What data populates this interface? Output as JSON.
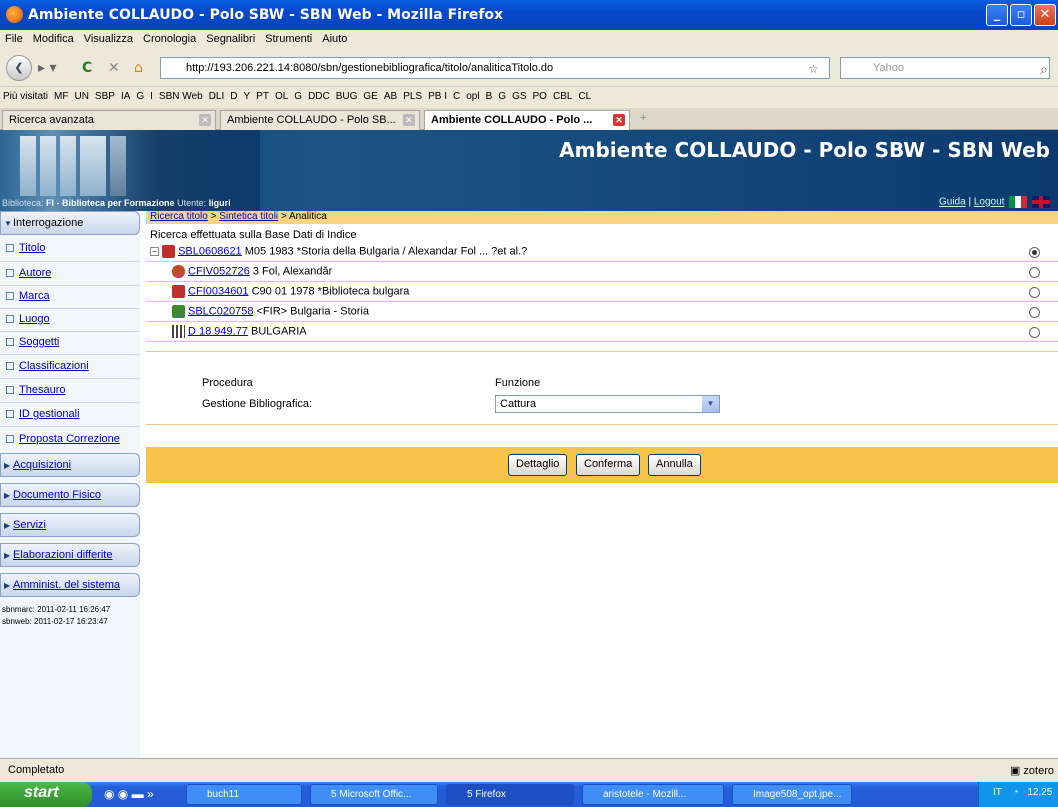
{
  "window": {
    "title": "Ambiente COLLAUDO - Polo SBW - SBN Web - Mozilla Firefox"
  },
  "menu": [
    "File",
    "Modifica",
    "Visualizza",
    "Cronologia",
    "Segnalibri",
    "Strumenti",
    "Aiuto"
  ],
  "nav": {
    "url": "http://193.206.221.14:8080/sbn/gestionebibliografica/titolo/analiticaTitolo.do",
    "search_placeholder": "Yahoo"
  },
  "bookmarks": [
    "Più visitati",
    "MF",
    "UN",
    "SBP",
    "IA",
    "G",
    "I",
    "SBN Web",
    "DLI",
    "D",
    "Y",
    "PT",
    "OL",
    "G",
    "DDC",
    "BUG",
    "GE",
    "AB",
    "PLS",
    "PB I",
    "C",
    "opl",
    "B",
    "G",
    "GS",
    "PO",
    "CBL",
    "CL"
  ],
  "tabs": [
    {
      "label": "Ricerca avanzata"
    },
    {
      "label": "Ambiente COLLAUDO - Polo SB..."
    },
    {
      "label": "Ambiente COLLAUDO - Polo ..."
    }
  ],
  "banner": {
    "title": "Ambiente COLLAUDO - Polo SBW - SBN Web",
    "biblioteca_label": "Biblioteca:",
    "biblioteca_value": "FI - Biblioteca per Formazione",
    "utente_label": "Utente:",
    "utente_value": "liguri",
    "guida": "Guida",
    "logout": "Logout"
  },
  "sidebar": {
    "interrogazione": "Interrogazione",
    "items": [
      "Titolo",
      "Autore",
      "Marca",
      "Luogo",
      "Soggetti",
      "Classificazioni",
      "Thesauro",
      "ID gestionali",
      "Proposta Correzione"
    ],
    "sections": [
      "Acquisizioni",
      "Documento Fisico",
      "Servizi",
      "Elaborazioni differite",
      "Amminist. del sistema"
    ],
    "stamp1": "sbnmarc: 2011-02-11 16:26:47",
    "stamp2": "sbnweb: 2011-02-17 16:23:47"
  },
  "breadcrumb": {
    "c1": "Ricerca titolo",
    "sep": " > ",
    "c2": "Sintetica titoli",
    "c3": "Analitica"
  },
  "main": {
    "search_note": "Ricerca effettuata sulla Base Dati di Indice",
    "records": [
      {
        "id": "SBL0608621",
        "text": " M05 1983 *Storia della Bulgaria / Alexandar Fol ... ?et al.?"
      },
      {
        "id": "CFIV052726",
        "text": " 3 Fol, Alexandăr"
      },
      {
        "id": "CFI0034601",
        "text": " C90 01 1978 *Biblioteca bulgara"
      },
      {
        "id": "SBLC020758",
        "text": " <FIR> Bulgaria - Storia"
      },
      {
        "id": "D 18 949.77",
        "text": " BULGARIA"
      }
    ],
    "procedura_label": "Procedura",
    "funzione_label": "Funzione",
    "gestione_label": "Gestione Bibliografica:",
    "select_value": "Cattura",
    "buttons": {
      "dettaglio": "Dettaglio",
      "conferma": "Conferma",
      "annulla": "Annulla"
    }
  },
  "status": {
    "text": "Completato",
    "zotero": "zotero"
  },
  "taskbar": {
    "start": "start",
    "tasks": [
      "buch11",
      "5 Microsoft Offic...",
      "5 Firefox",
      "aristotele - Mozill...",
      "Image508_opt.jpe..."
    ],
    "lang": "IT",
    "clock": "12.25"
  }
}
